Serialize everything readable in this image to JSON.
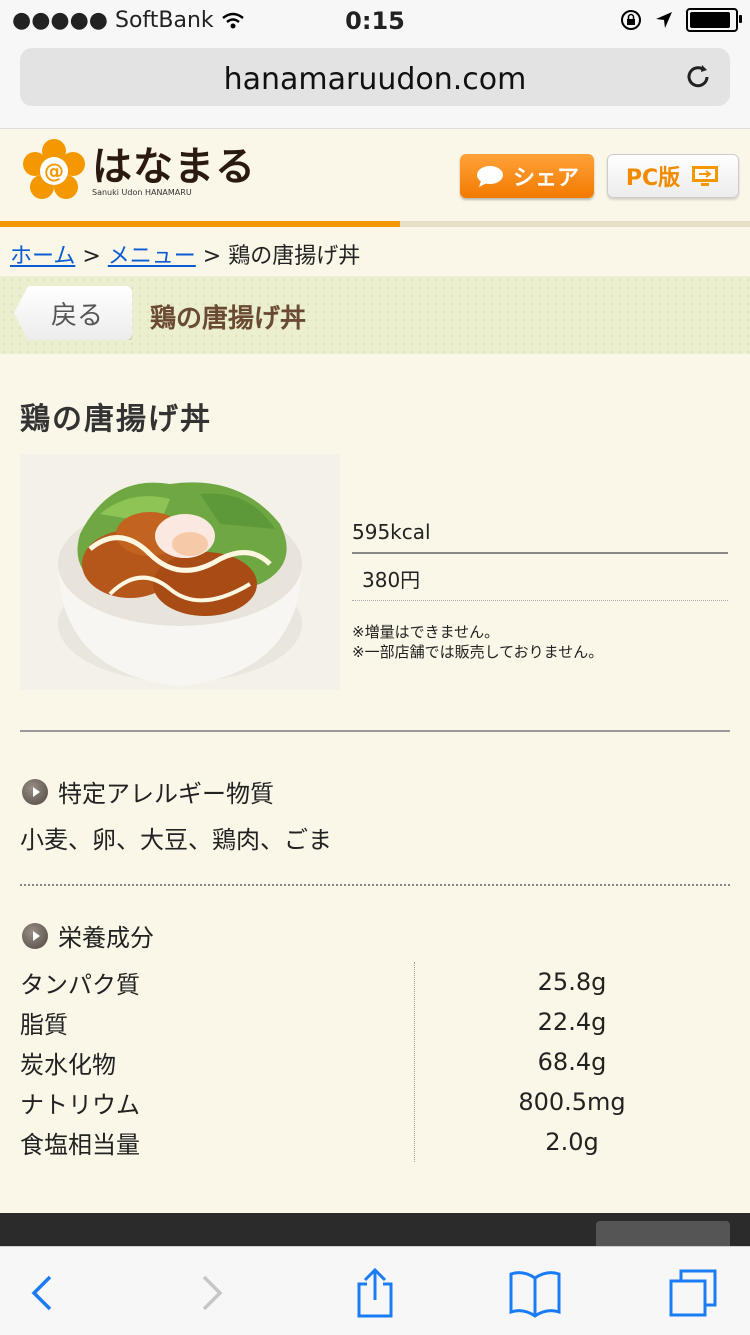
{
  "status": {
    "carrier": "SoftBank",
    "time": "0:15"
  },
  "browser": {
    "url": "hanamaruudon.com"
  },
  "header": {
    "brand": "はなまる",
    "brand_sub": "Sanuki Udon HANAMARU",
    "share_label": "シェア",
    "pc_label": "PC版"
  },
  "page_progress": 0.533,
  "breadcrumb": {
    "home": "ホーム",
    "sep1": ">",
    "menu": "メニュー",
    "sep2": ">",
    "current": "鶏の唐揚げ丼"
  },
  "titlebar": {
    "back_label": "戻る",
    "title": "鶏の唐揚げ丼"
  },
  "item": {
    "name": "鶏の唐揚げ丼",
    "kcal": "595kcal",
    "price": "380円",
    "note1": "※増量はできません。",
    "note2": "※一部店舗では販売しておりません。"
  },
  "allergy": {
    "heading": "特定アレルギー物質",
    "list": "小麦、卵、大豆、鶏肉、ごま"
  },
  "nutrition": {
    "heading": "栄養成分",
    "rows": [
      {
        "label": "タンパク質",
        "value": "25.8g"
      },
      {
        "label": "脂質",
        "value": "22.4g"
      },
      {
        "label": "炭水化物",
        "value": "68.4g"
      },
      {
        "label": "ナトリウム",
        "value": "800.5mg"
      },
      {
        "label": "食塩相当量",
        "value": "2.0g"
      }
    ]
  },
  "icons": [
    "wifi-icon",
    "lock-rotation-icon",
    "location-arrow-icon",
    "battery-icon",
    "reload-icon",
    "back-arrow-icon",
    "forward-arrow-icon",
    "share-icon",
    "bookmarks-icon",
    "tabs-icon"
  ],
  "colors": {
    "accent_orange": "#f39800",
    "link_blue": "#0b5bd3",
    "page_bg": "#fbf7e8",
    "ios_blue": "#1a7cf5"
  }
}
